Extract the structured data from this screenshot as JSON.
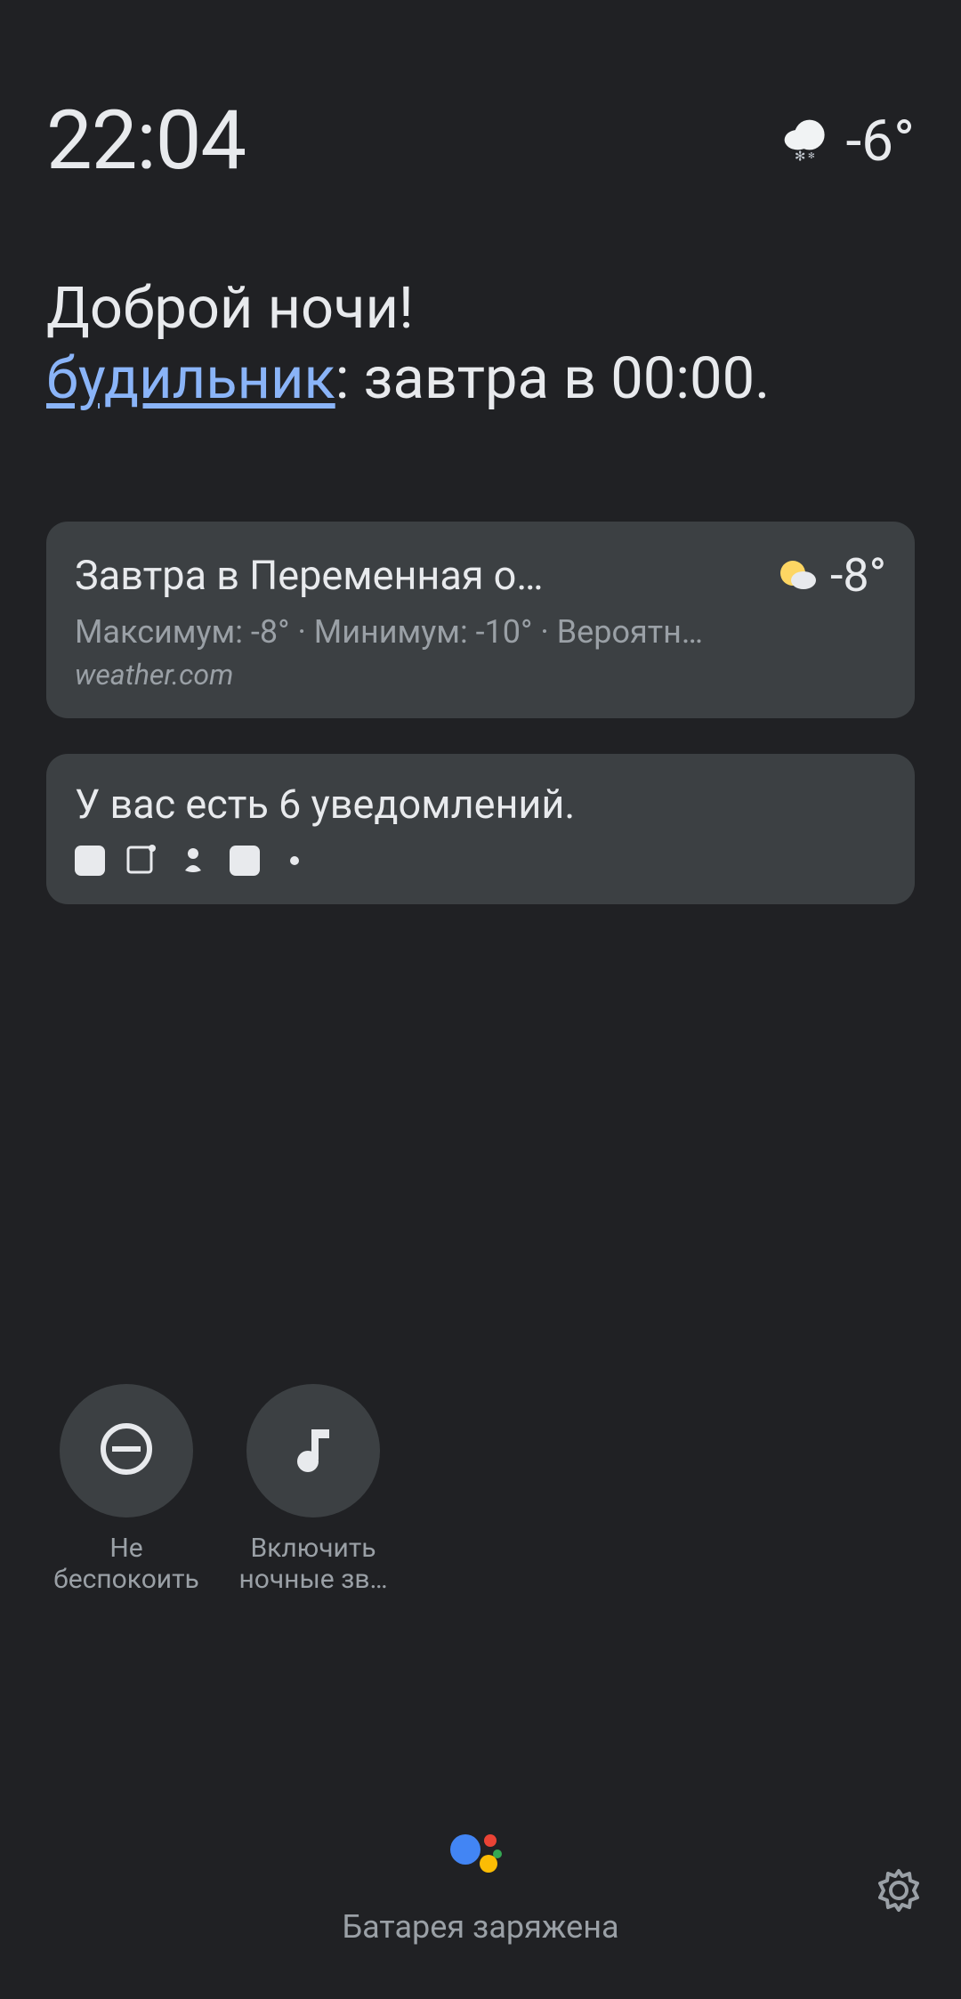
{
  "status": {
    "time": "22:04",
    "temp_now": "-6°"
  },
  "greeting": {
    "title": "Доброй ночи!",
    "alarm_link": "будильник",
    "alarm_rest": ": завтра в 00:00."
  },
  "weather_card": {
    "title": "Завтра в Переменная о…",
    "temp": "-8°",
    "subline": "Максимум: -8° · Минимум: -10° · Вероятн…",
    "source": "weather.com"
  },
  "notif_card": {
    "title": "У вас есть 6 уведомлений."
  },
  "actions": [
    {
      "label": "Не беспокоить"
    },
    {
      "label": "Включить ночные зв…"
    }
  ],
  "bottom": {
    "battery": "Батарея заряжена"
  }
}
